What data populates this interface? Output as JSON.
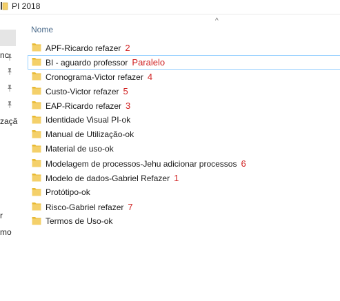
{
  "window": {
    "title": "PI 2018"
  },
  "nav": {
    "labels": [
      "nc",
      "zaçã",
      "r",
      "mo"
    ]
  },
  "header": {
    "name_column": "Nome",
    "sort_arrow": "^"
  },
  "items": [
    {
      "name": "APF-Ricardo refazer",
      "note": "2"
    },
    {
      "name": "BI - aguardo professor",
      "note": "Paralelo",
      "selected": true
    },
    {
      "name": "Cronograma-Victor refazer",
      "note": "4"
    },
    {
      "name": "Custo-Victor refazer",
      "note": "5"
    },
    {
      "name": "EAP-Ricardo refazer",
      "note": "3"
    },
    {
      "name": "Identidade Visual PI-ok",
      "note": ""
    },
    {
      "name": "Manual de Utilização-ok",
      "note": ""
    },
    {
      "name": "Material de uso-ok",
      "note": ""
    },
    {
      "name": "Modelagem de processos-Jehu adicionar processos",
      "note": "6"
    },
    {
      "name": "Modelo de dados-Gabriel Refazer",
      "note": "1"
    },
    {
      "name": "Protótipo-ok",
      "note": ""
    },
    {
      "name": "Risco-Gabriel refazer",
      "note": "7"
    },
    {
      "name": "Termos de Uso-ok",
      "note": ""
    }
  ],
  "colors": {
    "annotation": "#d02020",
    "folder": "#f4d06a",
    "selection_border": "#99d1ff"
  }
}
